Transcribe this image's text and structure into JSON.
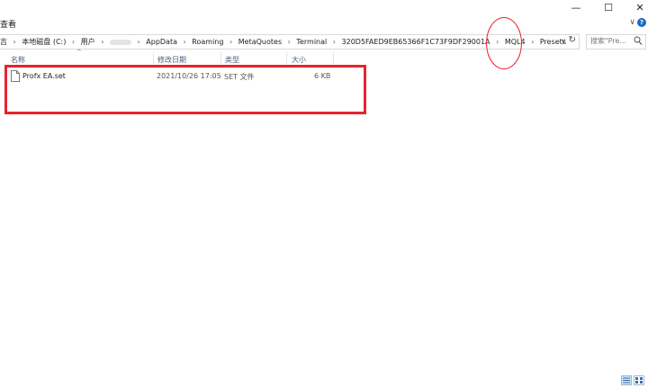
{
  "window": {
    "minimize_glyph": "—",
    "maximize_glyph": "☐",
    "close_glyph": "✕"
  },
  "ribbon": {
    "tab_label": "查看",
    "expand_glyph": "∨",
    "help_glyph": "?"
  },
  "address_bar": {
    "breadcrumb": [
      "本地磁盘 (C:)",
      "用户",
      "AppData",
      "Roaming",
      "MetaQuotes",
      "Terminal",
      "320D5FAED9EB65366F1C73F9DF29001A",
      "MQL4",
      "Presets"
    ],
    "separator": "›",
    "dropdown_glyph": "∨",
    "refresh_glyph": "↻"
  },
  "search": {
    "placeholder": "搜索\"Pre..."
  },
  "columns": [
    {
      "label": "名称"
    },
    {
      "label": "修改日期"
    },
    {
      "label": "类型"
    },
    {
      "label": "大小"
    }
  ],
  "sort_indicator": "^",
  "files": [
    {
      "name": "Profx EA.set",
      "modified": "2021/10/26 17:05",
      "type": "SET 文件",
      "size": "6 KB",
      "icon": "document-icon"
    }
  ],
  "annotations": {
    "highlight_color": "#e8232b"
  },
  "colors": {
    "column_header_text": "#4c607a",
    "view_toggle_border": "#9ab6d6"
  }
}
